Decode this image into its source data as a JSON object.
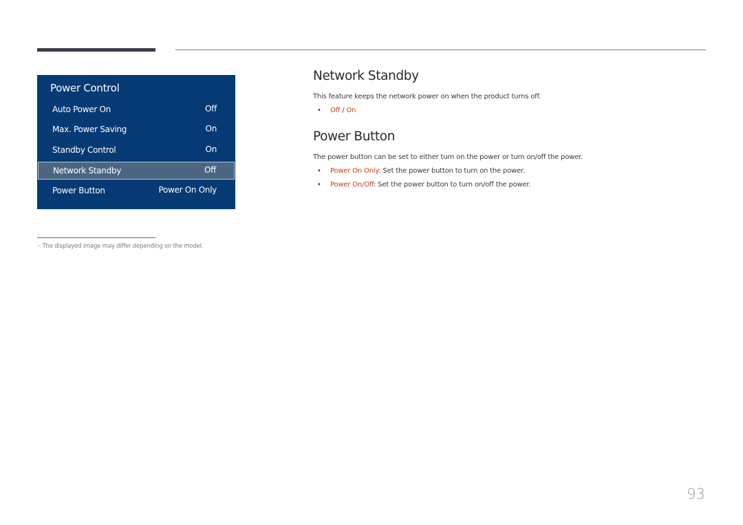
{
  "menu": {
    "title": "Power Control",
    "items": [
      {
        "label": "Auto Power On",
        "value": "Off"
      },
      {
        "label": "Max. Power Saving",
        "value": "On"
      },
      {
        "label": "Standby Control",
        "value": "On"
      },
      {
        "label": "Network Standby",
        "value": "Off",
        "selected": true
      },
      {
        "label": "Power Button",
        "value": "Power On Only"
      }
    ]
  },
  "footnote": "–  The displayed image may differ depending on the model.",
  "sections": {
    "network_standby": {
      "title": "Network Standby",
      "description": "This feature keeps the network power on when the product turns off.",
      "bullet_option_1": "Off",
      "bullet_sep": " / ",
      "bullet_option_2": "On"
    },
    "power_button": {
      "title": "Power Button",
      "description": "The power button can be set to either turn on the power or turn on/off the power.",
      "bullets": [
        {
          "term": "Power On Only",
          "text": ": Set the power button to turn on the power."
        },
        {
          "term": "Power On/Off",
          "text": ": Set the power button to turn on/off the power."
        }
      ]
    }
  },
  "bullet_glyph": "•",
  "page_number": "93",
  "colors": {
    "menu_bg": "#053a74",
    "menu_selected_bg": "#4b6683",
    "highlight_text": "#c5401b"
  }
}
